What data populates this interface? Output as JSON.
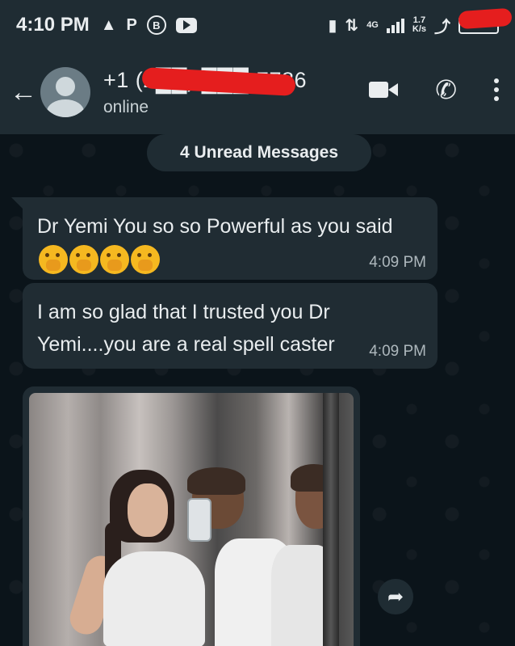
{
  "status_bar": {
    "time": "4:10 PM",
    "left_icons": [
      "flask-icon",
      "p-icon",
      "b-circle-icon",
      "youtube-icon"
    ],
    "network_type": "4G",
    "speed_value": "1.7",
    "speed_unit": "K/s"
  },
  "header": {
    "back_icon": "arrow-left-icon",
    "contact_name": "+1 (2██) ███-7786",
    "contact_status": "online",
    "actions": [
      "video-call-icon",
      "phone-icon",
      "more-vert-icon"
    ]
  },
  "chat": {
    "unread_label": "4 Unread Messages",
    "messages": [
      {
        "text": "Dr Yemi You so so Powerful as you said",
        "emoji_count": 4,
        "emoji_name": "face-with-hand-over-mouth-emoji",
        "time": "4:09 PM"
      },
      {
        "text": "I am so glad that I trusted you Dr Yemi....you are a real spell caster",
        "time": "4:09 PM"
      }
    ],
    "image_message": {
      "forward_icon": "forward-arrow-icon"
    }
  },
  "colors": {
    "background": "#0b141a",
    "header": "#1f2c33",
    "bubble_incoming": "#202c33",
    "text_primary": "#e9edef",
    "text_secondary": "#aeb8bd",
    "redaction": "#e51e1e"
  }
}
